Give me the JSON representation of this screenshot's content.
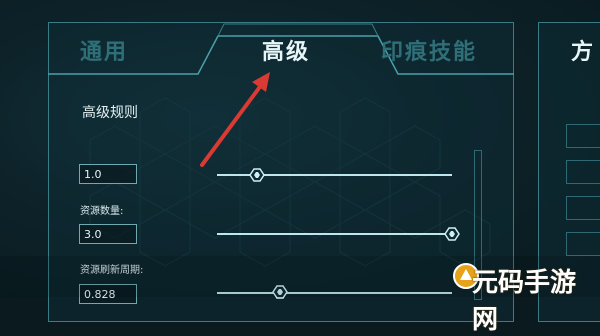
{
  "tabs": [
    {
      "label": "通用",
      "active": false
    },
    {
      "label": "高级",
      "active": true
    },
    {
      "label": "印痕技能",
      "active": false
    }
  ],
  "right_panel_tab": "方",
  "section_title": "高级规则",
  "settings": [
    {
      "label": "",
      "value": "1.0",
      "slider_fraction": 0.17
    },
    {
      "label": "资源数量:",
      "value": "3.0",
      "slider_fraction": 1.0
    },
    {
      "label": "资源刷新周期:",
      "value": "0.828",
      "slider_fraction": 0.27
    }
  ],
  "annotation": {
    "type": "red-arrow",
    "target": "tab-advanced"
  },
  "watermark": {
    "text": "元码手游网",
    "logo": "game-logo-icon"
  },
  "colors": {
    "accent": "#3a7c86",
    "active_text": "#e8f6f8",
    "inactive_text": "#2f6f78",
    "arrow": "#d93a34"
  }
}
